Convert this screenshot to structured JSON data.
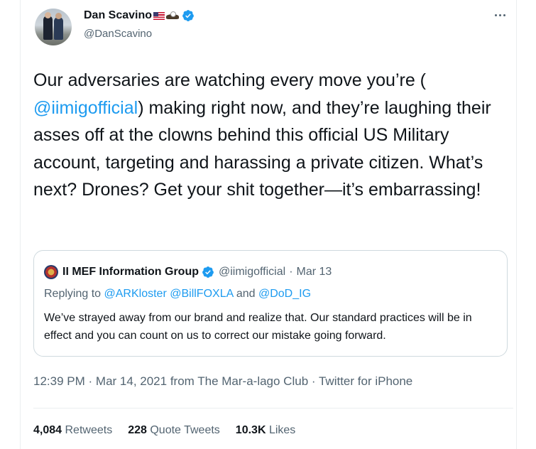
{
  "author": {
    "display_name": "Dan Scavino",
    "handle": "@DanScavino"
  },
  "tweet": {
    "text_before": "Our adversaries are watching every move you’re (",
    "mention": "@iimigofficial",
    "text_after": ") making right now, and they’re laughing their asses off at the clowns behind this official US Military account, targeting and harassing a private citizen. What’s next? Drones? Get your shit together—it’s embarrassing!"
  },
  "quoted": {
    "display_name": "II MEF Information Group",
    "handle": "@iimigofficial",
    "separator": "·",
    "date": "Mar 13",
    "replying_prefix": "Replying to",
    "reply_1": "@ARKloster",
    "reply_2": "@BillFOXLA",
    "reply_and": "and",
    "reply_3": "@DoD_IG",
    "body": "We’ve strayed away from our brand and realize that. Our standard practices will be in effect and you can count on us to correct our mistake going forward."
  },
  "meta": {
    "time": "12:39 PM",
    "separator": "·",
    "date": "Mar 14, 2021",
    "from_text": "from",
    "location": "The Mar-a-lago Club",
    "client": "Twitter for iPhone"
  },
  "stats": {
    "retweets_count": "4,084",
    "retweets_label": "Retweets",
    "quotes_count": "228",
    "quotes_label": "Quote Tweets",
    "likes_count": "10.3K",
    "likes_label": "Likes"
  },
  "colors": {
    "accent": "#1d9bf0",
    "secondary_text": "#536471",
    "border": "#cfd9de"
  },
  "icons": [
    "us-flag-icon",
    "eagle-icon",
    "verified-badge-icon",
    "more-options-icon"
  ]
}
